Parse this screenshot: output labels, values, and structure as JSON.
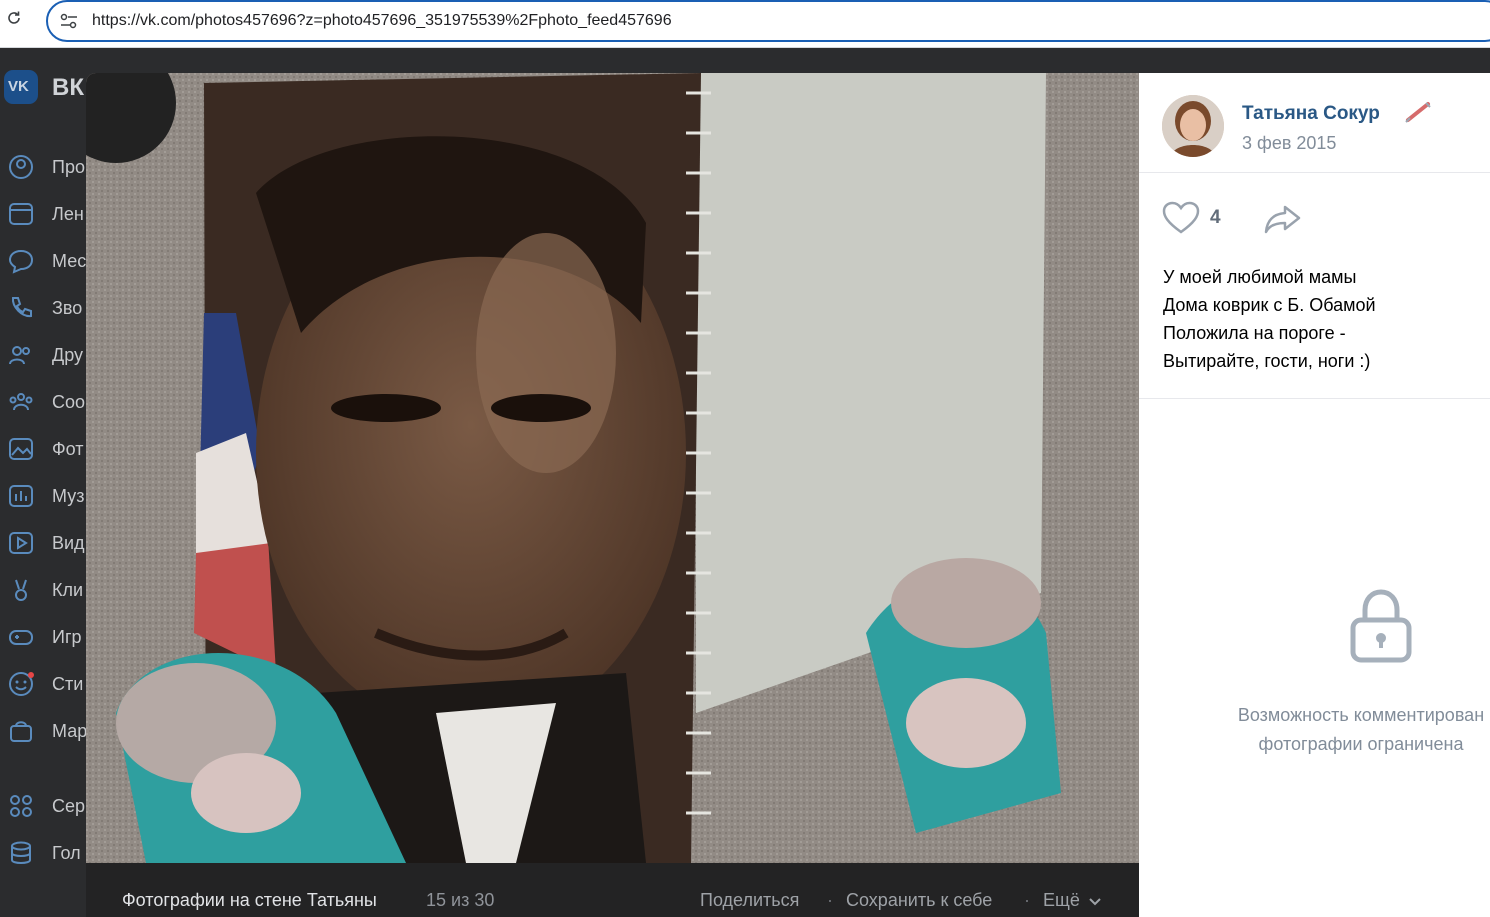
{
  "browser": {
    "url": "https://vk.com/photos457696?z=photo457696_351975539%2Fphoto_feed457696"
  },
  "vk": {
    "logo_text": "ВК",
    "menu": [
      {
        "label": "Про",
        "icon": "user-circle-icon"
      },
      {
        "label": "Лен",
        "icon": "news-feed-icon"
      },
      {
        "label": "Мес",
        "icon": "message-bubble-icon"
      },
      {
        "label": "Зво",
        "icon": "phone-icon"
      },
      {
        "label": "Дру",
        "icon": "friends-icon"
      },
      {
        "label": "Соо",
        "icon": "communities-icon"
      },
      {
        "label": "Фот",
        "icon": "photo-icon"
      },
      {
        "label": "Муз",
        "icon": "music-icon"
      },
      {
        "label": "Вид",
        "icon": "video-icon"
      },
      {
        "label": "Кли",
        "icon": "clips-icon"
      },
      {
        "label": "Игр",
        "icon": "gamepad-icon"
      },
      {
        "label": "Сти",
        "icon": "sticker-icon"
      },
      {
        "label": "Мар",
        "icon": "market-bag-icon"
      },
      {
        "label": "Сер",
        "icon": "services-grid-icon"
      },
      {
        "label": "Гол",
        "icon": "database-icon"
      }
    ]
  },
  "viewer": {
    "album_title": "Фотографии на стене Татьяны",
    "counter": "15 из 30",
    "actions": {
      "share": "Поделиться",
      "save": "Сохранить к себе",
      "more": "Ещё"
    }
  },
  "post": {
    "author": "Татьяна Сокур",
    "date": "3 фев 2015",
    "likes": "4",
    "caption": [
      "У моей любимой мамы",
      "Дома коврик с Б. Обамой",
      "Положила на пороге -",
      "Вытирайте, гости, ноги :)"
    ],
    "comments_restricted": [
      "Возможность комментирован",
      "фотографии ограничена"
    ]
  },
  "colors": {
    "link_blue": "#2a5885",
    "muted_gray": "#818c99",
    "slipper_teal": "#2fa0a0"
  }
}
